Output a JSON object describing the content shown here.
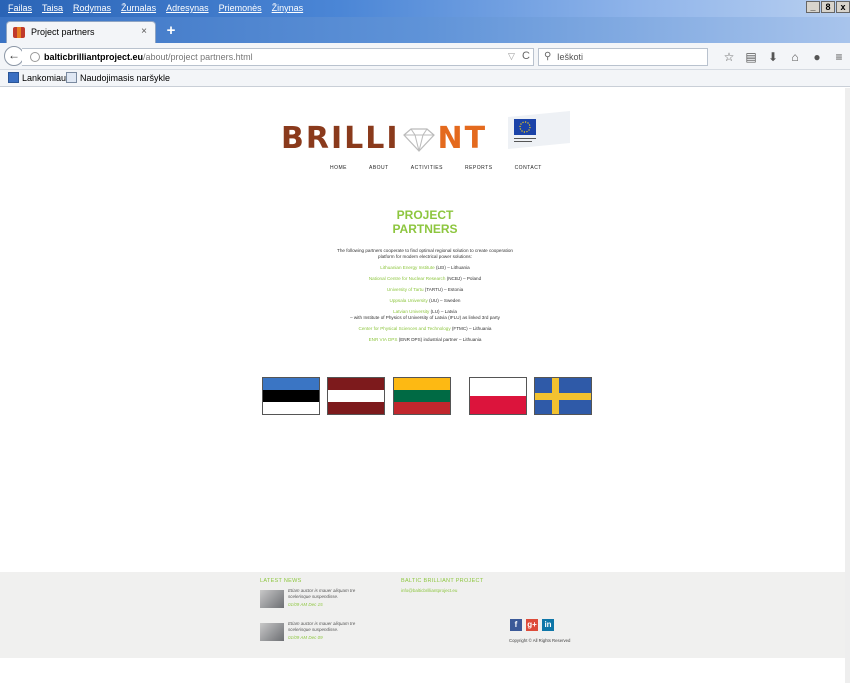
{
  "menu": [
    "Failas",
    "Taisa",
    "Rodymas",
    "Žurnalas",
    "Adresynas",
    "Priemonės",
    "Žinynas"
  ],
  "window_controls": [
    "_",
    "8",
    "x"
  ],
  "tab": {
    "title": "Project partners",
    "close": "×",
    "new": "+"
  },
  "url": {
    "host": "balticbrilliantproject.eu",
    "path": "/about/project partners.html"
  },
  "search": {
    "placeholder": "Ieškoti"
  },
  "toolbar_icons": [
    "star-icon",
    "clipboard-icon",
    "download-icon",
    "home-icon",
    "chat-icon",
    "menu-icon"
  ],
  "bookmarks": [
    {
      "label": "Lankomiausi"
    },
    {
      "label": "Naudojimasis naršykle"
    }
  ],
  "site": {
    "logo_left": "BRILLI",
    "logo_right": "NT",
    "nav": [
      "HOME",
      "ABOUT",
      "ACTIVITIES",
      "REPORTS",
      "CONTACT"
    ],
    "heading_line1": "PROJECT",
    "heading_line2": "PARTNERS",
    "intro": "The following partners cooperate to find optimal regional solution to create cooperation platform for modern electrical power solutions:",
    "partners": [
      {
        "name": "Lithuanian Energy Institute",
        "rest": " (LEI) – Lithuania"
      },
      {
        "name": "National Centre for Nuclear Research",
        "rest": " (NCBJ) – Poland"
      },
      {
        "name": "University of Tartu",
        "rest": " (TARTU) – Estonia"
      },
      {
        "name": "Uppsala University",
        "rest": " (UU) – Sweden"
      },
      {
        "name": "Latvian University",
        "rest": " (LU) – Latvia"
      },
      {
        "name": "Center for Physical Sciences and Technology",
        "rest": " (FTMC) – Lithuania"
      },
      {
        "name": "ENR VIA DPS",
        "rest": " (ENR DPS) industrial partner – Lithuania"
      }
    ],
    "partner_note": "– with Institute of Physics of University of Latvia (IFLU) as linked 3rd party"
  },
  "flags": [
    {
      "country": "Estonia",
      "stripes": [
        "#3a75c4",
        "#000000",
        "#ffffff"
      ]
    },
    {
      "country": "Latvia",
      "stripes": [
        "#7d1a1c",
        "#ffffff",
        "#7d1a1c"
      ]
    },
    {
      "country": "Lithuania",
      "stripes": [
        "#fdb913",
        "#006a44",
        "#c1272d"
      ]
    },
    {
      "country": "Poland",
      "stripes": [
        "#ffffff",
        "#dc143c"
      ]
    },
    {
      "country": "Sweden",
      "colors": {
        "field": "#2f5aa8",
        "cross": "#f2c230"
      }
    }
  ],
  "footer": {
    "latest_news": "LATEST NEWS",
    "news": [
      {
        "text": "Etiam auctor is mauer aliquam tre scelerisque suspendisse.",
        "date": "01/09 AM Dec 15"
      },
      {
        "text": "Etiam auctor is mauer aliquam tre scelerisque suspendisse.",
        "date": "01/09 AM Dec 09"
      }
    ],
    "project_heading": "BALTIC BRILLIANT PROJECT",
    "email": "info@balticbrilliantproject.eu",
    "social": [
      "f",
      "g+",
      "in"
    ],
    "copyright": "Copyright © All Rights Reserved"
  }
}
